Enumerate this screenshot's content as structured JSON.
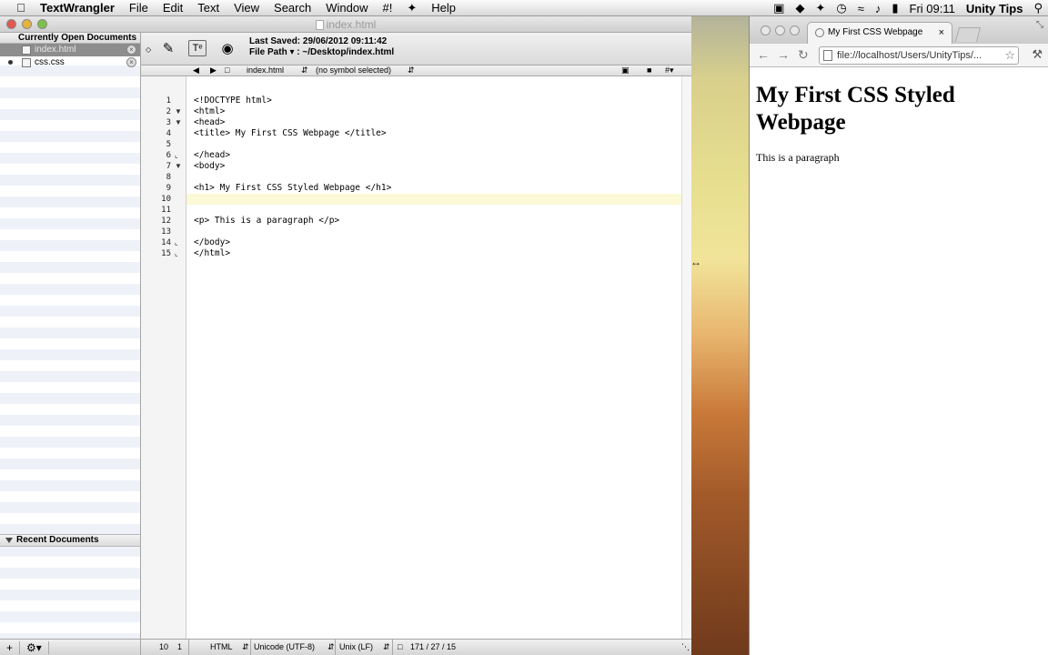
{
  "menubar": {
    "app": "TextWrangler",
    "items": [
      "File",
      "Edit",
      "Text",
      "View",
      "Search",
      "Window",
      "#!",
      "Help"
    ],
    "clock": "Fri 09:11",
    "user": "Unity Tips"
  },
  "textwrangler": {
    "window_title": "index.html",
    "sidebar": {
      "open_header": "Currently Open Documents",
      "docs": [
        "index.html",
        "css.css"
      ],
      "recent_header": "Recent Documents"
    },
    "toolbar": {
      "last_saved": "Last Saved: 29/06/2012 09:11:42",
      "file_path": "File Path ▾ : ~/Desktop/index.html"
    },
    "nav": {
      "file": "index.html",
      "symbol": "(no symbol selected)"
    },
    "code_lines": [
      "<!DOCTYPE html>",
      "<html>",
      "<head>",
      "<title> My First CSS Webpage </title>",
      "",
      "</head>",
      "<body>",
      "",
      "<h1> My First CSS Styled Webpage </h1>",
      "",
      "",
      "<p> This is a paragraph </p>",
      "",
      "</body>",
      "</html>"
    ],
    "line_numbers": [
      "1",
      "2",
      "3",
      "4",
      "5",
      "6",
      "7",
      "8",
      "9",
      "10",
      "11",
      "12",
      "13",
      "14",
      "15"
    ],
    "status": {
      "line": "10",
      "col": "1",
      "language": "HTML",
      "encoding": "Unicode (UTF-8)",
      "line_endings": "Unix (LF)",
      "counts": "171 / 27 / 15"
    }
  },
  "browser": {
    "tab_title": "My First CSS Webpage",
    "url": "file://localhost/Users/UnityTips/...",
    "heading": "My First CSS Styled Webpage",
    "paragraph": "This is a paragraph"
  }
}
